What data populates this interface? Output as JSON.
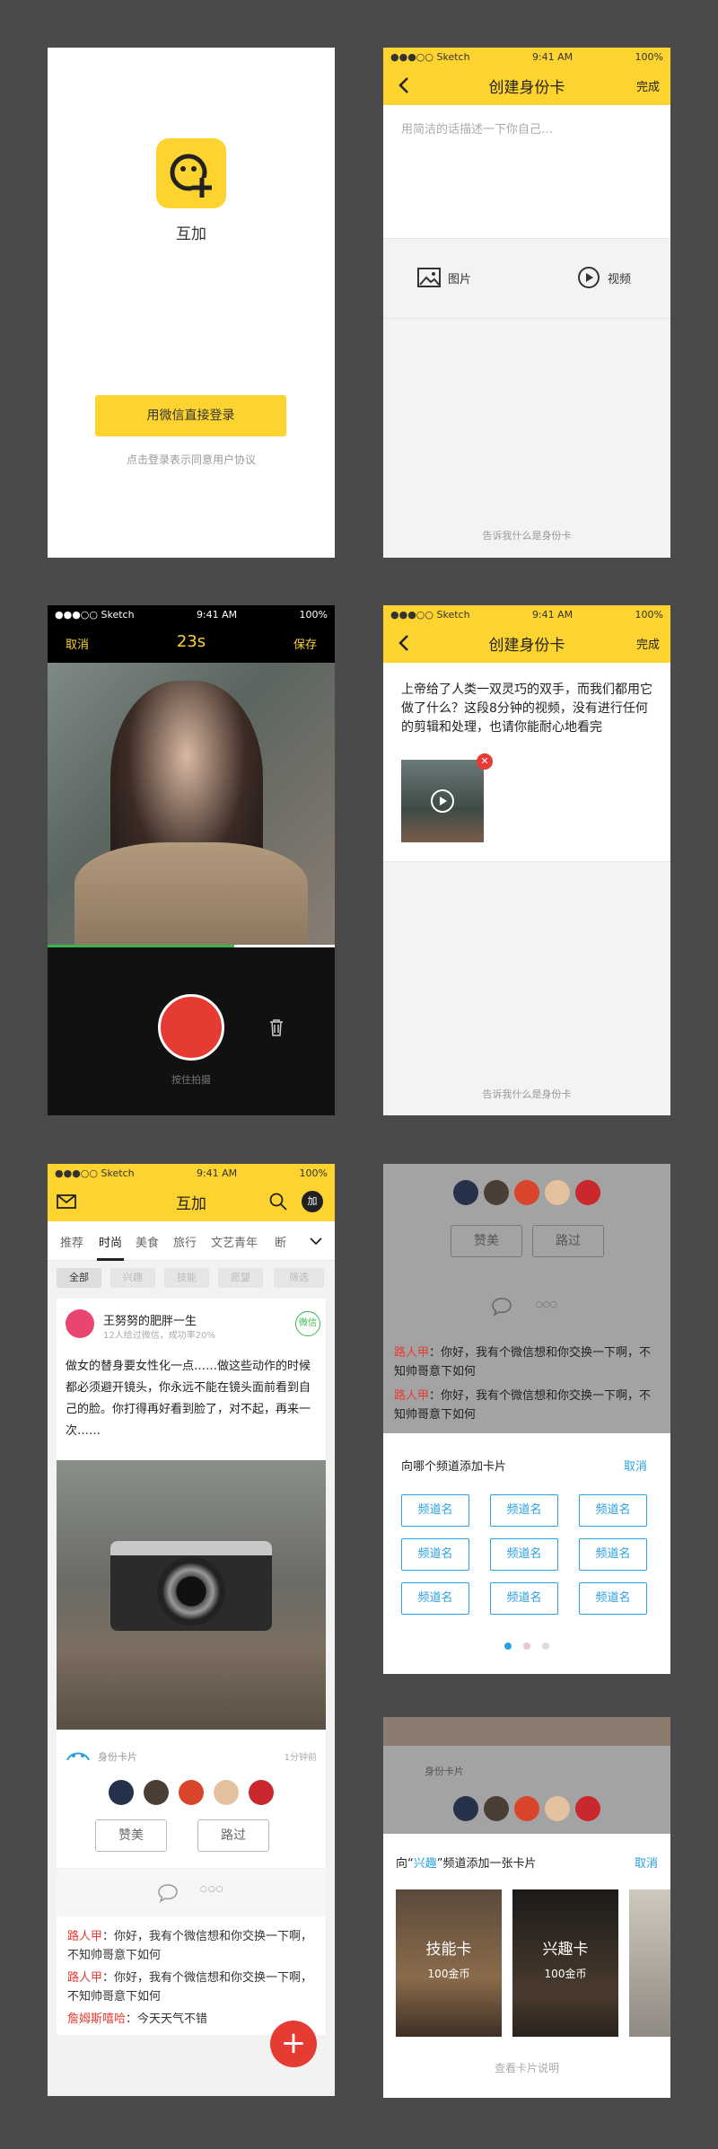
{
  "s1": {
    "app_name": "互加",
    "wechat_login": "用微信直接登录",
    "agreement": "点击登录表示同意用户协议"
  },
  "status": {
    "carrier": "●●●○○ Sketch",
    "time": "9:41 AM",
    "battery": "100%"
  },
  "s2": {
    "title": "创建身份卡",
    "done": "完成",
    "placeholder": "用简洁的话描述一下你自己…",
    "image_label": "图片",
    "video_label": "视频",
    "footer": "告诉我什么是身份卡"
  },
  "s3": {
    "cancel": "取消",
    "timer": "23s",
    "save": "保存",
    "hint": "按住拍摄",
    "progress": 0.65
  },
  "s4": {
    "title": "创建身份卡",
    "done": "完成",
    "text": "上帝给了人类一双灵巧的双手，而我们都用它做了什么？这段8分钟的视频，没有进行任何的剪辑和处理，也请你能耐心地看完",
    "footer": "告诉我什么是身份卡"
  },
  "s5": {
    "title": "互加",
    "plus_badge": "加",
    "tabs": [
      "推荐",
      "时尚",
      "美食",
      "旅行",
      "文艺青年",
      "断"
    ],
    "filters": [
      "全部",
      "兴趣",
      "技能",
      "愿望",
      "筛选"
    ],
    "user_name": "王努努的肥胖一生",
    "user_meta": "12人给过微信，成功率20%",
    "wechat_badge": "微信",
    "post_text": "做女的替身要女性化一点……做这些动作的时候都必须避开镜头，你永远不能在镜头面前看到自己的脸。你打得再好看到脸了，对不起，再来一次……",
    "card_label": "身份卡片",
    "card_time": "1分钟前",
    "praise": "赞美",
    "pass": "路过",
    "more": "○○○",
    "comments": [
      {
        "name": "路人甲",
        "text": "：你好，我有个微信想和你交换一下啊，不知帅哥意下如何"
      },
      {
        "name": "路人甲",
        "text": "：你好，我有个微信想和你交换一下啊，不知帅哥意下如何"
      },
      {
        "name": "詹姆斯嘻哈",
        "text": "：今天天气不错"
      }
    ]
  },
  "s6": {
    "praise": "赞美",
    "pass": "路过",
    "more": "○○○",
    "comments": [
      {
        "name": "路人甲",
        "text": "：你好，我有个微信想和你交换一下啊，不知帅哥意下如何"
      },
      {
        "name": "路人甲",
        "text": "：你好，我有个微信想和你交换一下啊，不知帅哥意下如何"
      }
    ],
    "sheet_title": "向哪个频道添加卡片",
    "cancel": "取消",
    "channels": [
      "频道名",
      "频道名",
      "频道名",
      "频道名",
      "频道名",
      "频道名",
      "频道名",
      "频道名",
      "频道名"
    ]
  },
  "s7": {
    "card_label": "身份卡片",
    "sheet_prefix": "向“",
    "sheet_channel": "兴趣",
    "sheet_suffix": "”频道添加一张卡片",
    "cancel": "取消",
    "cards": [
      {
        "name": "技能卡",
        "price": "100金币"
      },
      {
        "name": "兴趣卡",
        "price": "100金币"
      }
    ],
    "footer": "查看卡片说明"
  },
  "colors": {
    "yellow": "#fdd32f",
    "red": "#e63b33",
    "blue": "#2aa0e0"
  }
}
